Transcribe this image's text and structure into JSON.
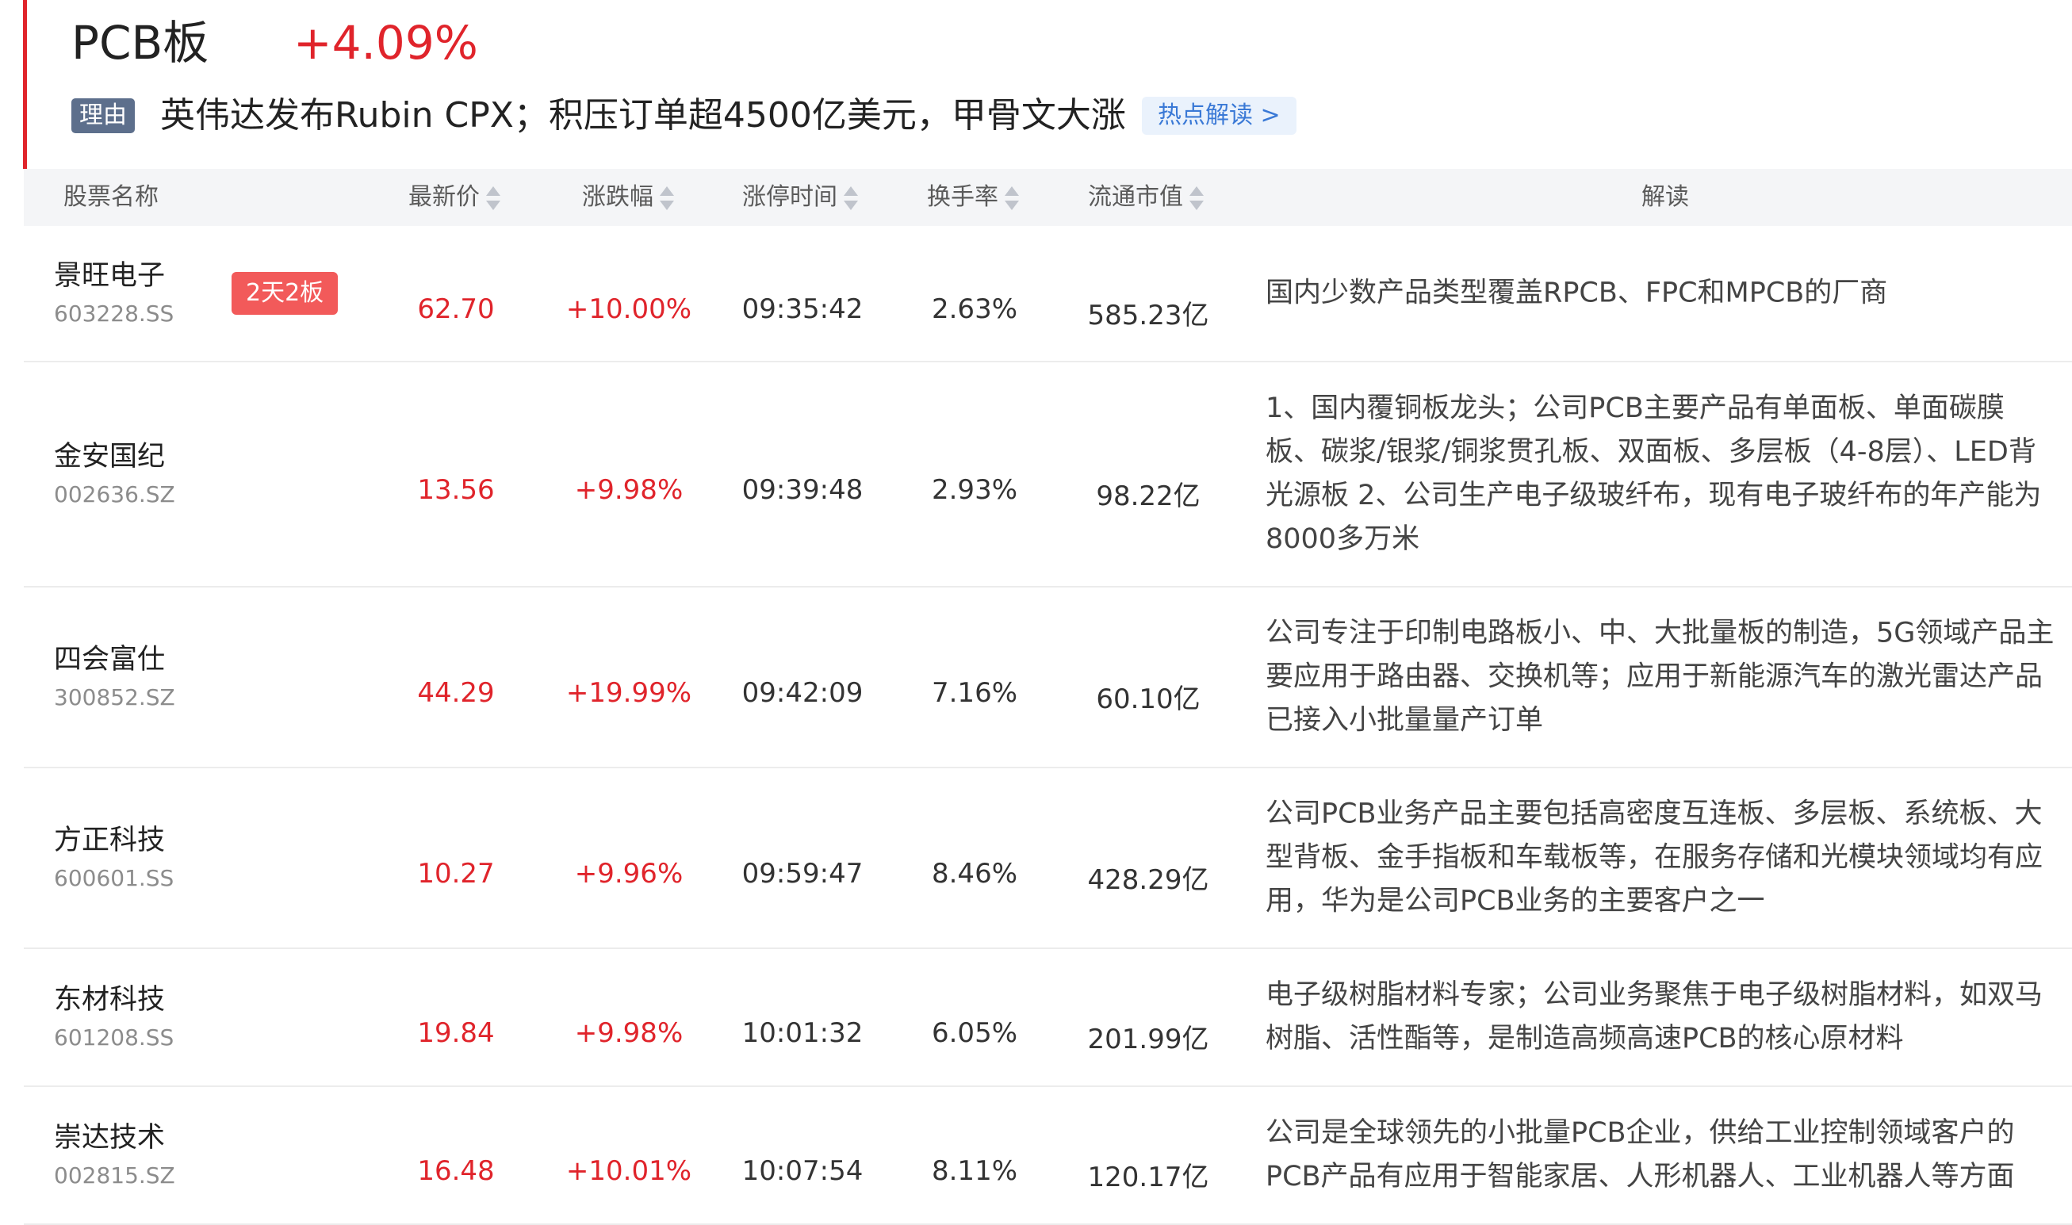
{
  "header": {
    "title": "PCB板",
    "change": "+4.09%",
    "reason_tag": "理由",
    "reason_text": "英伟达发布Rubin CPX；积压订单超4500亿美元，甲骨文大涨",
    "hot_link": "热点解读 >"
  },
  "table": {
    "headers": {
      "name": "股票名称",
      "price": "最新价",
      "change": "涨跌幅",
      "limit_time": "涨停时间",
      "turnover": "换手率",
      "market_cap": "流通市值",
      "analysis": "解读"
    },
    "rows": [
      {
        "name": "景旺电子",
        "code": "603228.SS",
        "badge": "2天2板",
        "price": "62.70",
        "change": "+10.00%",
        "limit_time": "09:35:42",
        "turnover": "2.63%",
        "market_cap": "585.23亿",
        "analysis": "国内少数产品类型覆盖RPCB、FPC和MPCB的厂商"
      },
      {
        "name": "金安国纪",
        "code": "002636.SZ",
        "badge": "",
        "price": "13.56",
        "change": "+9.98%",
        "limit_time": "09:39:48",
        "turnover": "2.93%",
        "market_cap": "98.22亿",
        "analysis": "1、国内覆铜板龙头；公司PCB主要产品有单面板、单面碳膜板、碳浆/银浆/铜浆贯孔板、双面板、多层板（4-8层）、LED背光源板 2、公司生产电子级玻纤布，现有电子玻纤布的年产能为8000多万米"
      },
      {
        "name": "四会富仕",
        "code": "300852.SZ",
        "badge": "",
        "price": "44.29",
        "change": "+19.99%",
        "limit_time": "09:42:09",
        "turnover": "7.16%",
        "market_cap": "60.10亿",
        "analysis": "公司专注于印制电路板小、中、大批量板的制造，5G领域产品主要应用于路由器、交换机等；应用于新能源汽车的激光雷达产品已接入小批量量产订单"
      },
      {
        "name": "方正科技",
        "code": "600601.SS",
        "badge": "",
        "price": "10.27",
        "change": "+9.96%",
        "limit_time": "09:59:47",
        "turnover": "8.46%",
        "market_cap": "428.29亿",
        "analysis": "公司PCB业务产品主要包括高密度互连板、多层板、系统板、大型背板、金手指板和车载板等，在服务存储和光模块领域均有应用，华为是公司PCB业务的主要客户之一"
      },
      {
        "name": "东材科技",
        "code": "601208.SS",
        "badge": "",
        "price": "19.84",
        "change": "+9.98%",
        "limit_time": "10:01:32",
        "turnover": "6.05%",
        "market_cap": "201.99亿",
        "analysis": "电子级树脂材料专家；公司业务聚焦于电子级树脂材料，如双马树脂、活性酯等，是制造高频高速PCB的核心原材料"
      },
      {
        "name": "崇达技术",
        "code": "002815.SZ",
        "badge": "",
        "price": "16.48",
        "change": "+10.01%",
        "limit_time": "10:07:54",
        "turnover": "8.11%",
        "market_cap": "120.17亿",
        "analysis": "公司是全球领先的小批量PCB企业，供给工业控制领域客户的PCB产品有应用于智能家居、人形机器人、工业机器人等方面"
      }
    ]
  },
  "colors": {
    "accent": "#e0242b",
    "up": "#e0242b",
    "badge": "#f25a5a",
    "tag": "#5d6f8c",
    "link": "#3a79d6"
  }
}
